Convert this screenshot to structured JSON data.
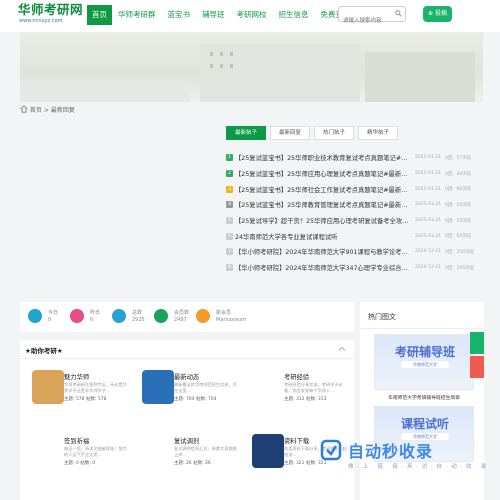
{
  "header": {
    "logo_name": "华师考研网",
    "logo_url": "www.ncnuyz.com",
    "nav": [
      "首页",
      "华师考研群",
      "蓝宝书",
      "辅导班",
      "考研网校",
      "招生信息",
      "免费资料"
    ],
    "search_placeholder": "请输入搜索内容",
    "post_label": "投稿"
  },
  "breadcrumb": {
    "home": "首页",
    "sep": ">",
    "current": "最新回复"
  },
  "hot": {
    "tabs": [
      "最新帖子",
      "最新回复",
      "热门帖子",
      "精华帖子"
    ],
    "rows": [
      {
        "n": "1",
        "color": "#2fae5d",
        "title": "【25复试蓝宝书】25华师职业技术教育复试考点真题笔记#最新版...",
        "date": "2025-01-21",
        "replies": "0回",
        "views": "57浏览"
      },
      {
        "n": "2",
        "color": "#2fae5d",
        "title": "【25复试蓝宝书】25华师应用心理复试考点真题笔记#最新版...",
        "date": "2025-01-21",
        "replies": "0回",
        "views": "48浏览"
      },
      {
        "n": "3",
        "color": "#e8b923",
        "title": "【25复试蓝宝书】25华师社会工作复试考点真题笔记#最新版...",
        "date": "2025-01-21",
        "replies": "0回",
        "views": "66浏览"
      },
      {
        "n": "4",
        "color": "#999999",
        "title": "【25复试蓝宝书】25华师教育管理复试考点真题笔记#最新版...",
        "date": "2025-01-21",
        "replies": "0回",
        "views": "54浏览"
      },
      {
        "n": "5",
        "color": "#cccccc",
        "title": "【25复试导学】超干货！25华师应用心理考研复试备考全攻略！",
        "date": "2025-01-21",
        "replies": "0回",
        "views": "55浏览"
      },
      {
        "n": "6",
        "color": "#cccccc",
        "title": "24华南师范大学各专业复试课程试听",
        "date": "2025-01-21",
        "replies": "0回",
        "views": "64浏览"
      },
      {
        "n": "7",
        "color": "#cccccc",
        "title": "【华小师考研院】2024年华南师范大学901课程与教学论考研...",
        "date": "2024-12-21",
        "replies": "0回",
        "views": "256浏览"
      },
      {
        "n": "8",
        "color": "#cccccc",
        "title": "【华小师考研院】2024年华南师范大学347心理学专业综合考...",
        "date": "2024-12-21",
        "replies": "0回",
        "views": "295浏览"
      }
    ]
  },
  "stats": [
    {
      "label": "今日",
      "value": "0",
      "color": "#1fa6c9"
    },
    {
      "label": "昨日",
      "value": "0",
      "color": "#e84a8a"
    },
    {
      "label": "总数",
      "value": "2925",
      "color": "#2aa0d8"
    },
    {
      "label": "会员数",
      "value": "2497",
      "color": "#1aa35a"
    },
    {
      "label": "新会员",
      "value": "Mariuoreum",
      "color": "#f29b28"
    }
  ],
  "forum": {
    "title": "★助你考研★",
    "boards": [
      {
        "name": "魅力华师",
        "desc": "华师考研新生报到专区，无论是华师学子还是非华师学子...",
        "topics": "主题: 578",
        "posts": "帖数: 578",
        "color": "#d9a45a"
      },
      {
        "name": "最新动态",
        "desc": "最新最全的华南师范招生信息，尽在这里...",
        "topics": "主题: 704",
        "posts": "帖数: 704",
        "color": "#2a6fb8"
      },
      {
        "name": "考研经验",
        "desc": "考研经验分享交流，考研学子必看，你会发现每个华师人...",
        "topics": "主题: 312",
        "posts": "帖数: 313",
        "color": "#ffffff"
      },
      {
        "name": "签到祈福",
        "desc": "每日一签，祈求文曲星保佑！努力的人运气不会太差...",
        "topics": "主题: 0",
        "posts": "帖数: 0",
        "color": "#ffffff"
      },
      {
        "name": "复试调剂",
        "desc": "复试调剂信息汇总，祝愿大家都能上岸...",
        "topics": "主题: 26",
        "posts": "帖数: 26",
        "color": "#ffffff"
      },
      {
        "name": "资料下载",
        "desc": "各类资料下载分享，考研路上一起加油...",
        "topics": "主题: 321",
        "posts": "帖数: 321",
        "color": "#1d3f73"
      }
    ]
  },
  "sidebar": {
    "title": "热门图文",
    "items": [
      {
        "big": "考研辅导班",
        "sub": "华南师范大学",
        "caption": "华南师范大学考研辅导班招生简章"
      },
      {
        "big": "课程试听",
        "sub": "华南师范大学",
        "caption": ""
      }
    ]
  },
  "watermark": {
    "text": "自动秒收录",
    "sub": "做 · 上 · 链 · 接 · 来 · 访 · 自 · 动 · 收 · 录"
  }
}
